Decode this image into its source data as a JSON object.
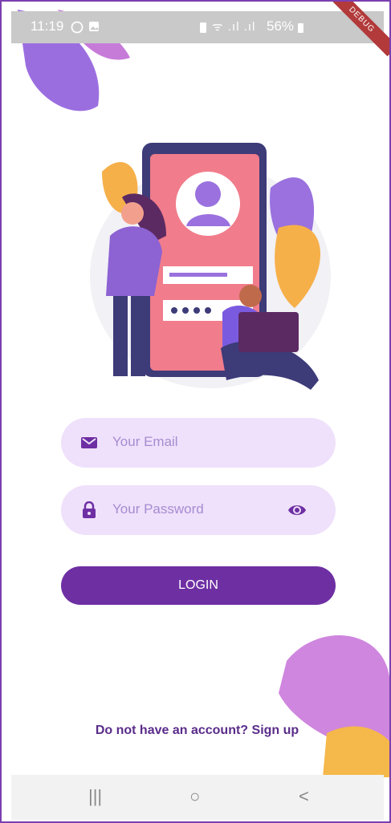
{
  "status_bar": {
    "time": "11:19",
    "signal_text": "ᯤ .ıl .ıl",
    "battery": "56%",
    "debug_banner": "DEBUG"
  },
  "form": {
    "email_placeholder": "Your Email",
    "password_placeholder": "Your Password",
    "login_label": "LOGIN",
    "signup_text": "Do not have an account? Sign up"
  },
  "nav": {
    "recent": "|||",
    "home": "○",
    "back": "<"
  },
  "colors": {
    "accent": "#6e2fa3",
    "field_bg": "#efe1fb",
    "field_text": "#a78bd0"
  },
  "icons": [
    "mail-icon",
    "lock-icon",
    "eye-icon",
    "whatsapp-icon",
    "image-icon",
    "wifi-icon",
    "signal-icon",
    "battery-icon"
  ]
}
